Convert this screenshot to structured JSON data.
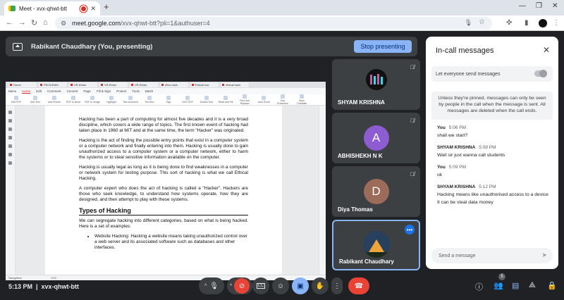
{
  "browser": {
    "tab_title": "Meet - xvx-qhwt-btt",
    "url_host": "meet.google.com",
    "url_path": "/xvx-qhwt-btt?pli=1&authuser=4",
    "colors": {
      "tab_bar": "#dee3ea",
      "recording_dot": "#d93025"
    }
  },
  "presenting_bar": {
    "text": "Rabikant Chaudhary (You, presenting)",
    "stop_label": "Stop presenting",
    "accent": "#8ab4f8"
  },
  "shared_screen": {
    "app_tabs": [
      "Home",
      "PROGRAM",
      "VR-Ethan",
      "VR-Ethan",
      "VR-Ethan",
      "ethic.hack",
      "Ethical hac",
      "ethical hack"
    ],
    "menu": [
      "Menu",
      "Home",
      "Edit",
      "Comment",
      "Convert",
      "Page",
      "Fill & Sign",
      "Protect",
      "Tools",
      "Batch"
    ],
    "active_menu": "Home",
    "ribbon": [
      "Edit PDF",
      "Add Text",
      "Add Picture",
      "PDF to Word",
      "PDF to Image",
      "Highlight",
      "Text comment",
      "Text Box",
      "Sign",
      "OCR PDF",
      "Extract Text",
      "Read and Fill",
      "Find and Replace",
      "Auto Scroll",
      "Eye Protection",
      "Sync Translate"
    ],
    "paragraphs": [
      "Hacking has been a part of computing for almost five decades and it is a very broad discipline, which covers a wide range of topics. The first known event of hacking had taken place in 1960 at MIT and at the same time, the term \"Hacker\" was originated.",
      "Hacking is the act of finding the possible entry points that exist in a computer system or a computer network and finally entering into them. Hacking is usually done to gain unauthorized access to a computer system or a computer network, either to harm the systems or to steal sensitive information available on the computer.",
      "Hacking is usually legal as long as it is being done to find weaknesses in a computer or network system for testing purpose. This sort of hacking is what we call Ethical Hacking.",
      "A computer expert who does the act of hacking is called a \"Hacker\". Hackers are those who seek knowledge, to understand how systems operate, how they are designed, and then attempt to play with these systems."
    ],
    "heading": "Types of Hacking",
    "after_heading": "We can segregate hacking into different categories, based on what is being hacked. Here is a set of examples:",
    "bullet": "Website Hacking: Hacking a website means taking unauthorized control over a web server and its associated software such as databases and other interfaces.",
    "status_left": "Navigation",
    "status_page": "1/15"
  },
  "participants": [
    {
      "name": "SHYAM KRISHNA",
      "initial": "",
      "color": "#3c4043"
    },
    {
      "name": "ABHISHEKH N K",
      "initial": "A",
      "color": "#8e5cd1"
    },
    {
      "name": "Diya Thomas",
      "initial": "D",
      "color": "#9c6b5a"
    },
    {
      "name": "Rabikant Chaudhary",
      "initial": "",
      "color": "#4a4e52"
    }
  ],
  "chat": {
    "header": "In-call messages",
    "toggle_label": "Let everyone send messages",
    "notice": "Unless they're pinned, messages can only be seen by people in the call when the message is sent. All messages are deleted when the call ends.",
    "messages": [
      {
        "sender": "You",
        "time": "5:06 PM",
        "lines": [
          "shall we start?"
        ]
      },
      {
        "sender": "SHYAM KRISHNA",
        "time": "5:08 PM",
        "lines": [
          "Wait sir just wanna call students"
        ]
      },
      {
        "sender": "You",
        "time": "5:09 PM",
        "lines": [
          "ok"
        ]
      },
      {
        "sender": "SHYAM KRISHNA",
        "time": "5:12 PM",
        "lines": [
          "Hacking means like unauthorised access to a device",
          "It can be steal data money"
        ]
      }
    ],
    "input_placeholder": "Send a message"
  },
  "bottom_bar": {
    "time": "5:13 PM",
    "meeting_code": "xvx-qhwt-btt",
    "people_count": "5",
    "colors": {
      "hangup": "#ea4335",
      "present_active": "#8ab4f8"
    }
  }
}
